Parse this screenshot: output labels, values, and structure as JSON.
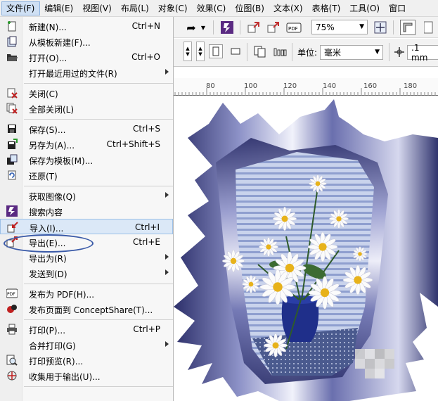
{
  "menubar": {
    "items": [
      "文件(F)",
      "编辑(E)",
      "视图(V)",
      "布局(L)",
      "对象(C)",
      "效果(C)",
      "位图(B)",
      "文本(X)",
      "表格(T)",
      "工具(O)",
      "窗口"
    ]
  },
  "toolbar": {
    "zoom_value": "75%",
    "units_label": "单位:",
    "units_value": "毫米",
    "nudge_value": ".1 mm"
  },
  "ruler": {
    "labels": [
      "80",
      "100",
      "120",
      "140",
      "160",
      "180"
    ]
  },
  "file_menu": {
    "items": [
      {
        "label": "新建(N)...",
        "shortcut": "Ctrl+N",
        "icon": "new-document-icon"
      },
      {
        "label": "从模板新建(F)...",
        "shortcut": "",
        "icon": "new-from-template-icon"
      },
      {
        "label": "打开(O)...",
        "shortcut": "Ctrl+O",
        "icon": "open-folder-icon"
      },
      {
        "label": "打开最近用过的文件(R)",
        "shortcut": "",
        "icon": ""
      },
      {
        "label": "关闭(C)",
        "shortcut": "",
        "icon": "close-document-icon"
      },
      {
        "label": "全部关闭(L)",
        "shortcut": "",
        "icon": "close-all-icon"
      },
      {
        "label": "保存(S)...",
        "shortcut": "Ctrl+S",
        "icon": "save-icon"
      },
      {
        "label": "另存为(A)...",
        "shortcut": "Ctrl+Shift+S",
        "icon": "save-as-icon"
      },
      {
        "label": "保存为模板(M)...",
        "shortcut": "",
        "icon": "save-template-icon"
      },
      {
        "label": "还原(T)",
        "shortcut": "",
        "icon": "revert-icon"
      },
      {
        "label": "获取图像(Q)",
        "shortcut": "",
        "icon": ""
      },
      {
        "label": "搜索内容",
        "shortcut": "",
        "icon": "search-content-icon"
      },
      {
        "label": "导入(I)...",
        "shortcut": "Ctrl+I",
        "icon": "import-icon"
      },
      {
        "label": "导出(E)...",
        "shortcut": "Ctrl+E",
        "icon": "export-icon"
      },
      {
        "label": "导出为(R)",
        "shortcut": "",
        "icon": ""
      },
      {
        "label": "发送到(D)",
        "shortcut": "",
        "icon": ""
      },
      {
        "label": "发布为 PDF(H)...",
        "shortcut": "",
        "icon": "pdf-icon"
      },
      {
        "label": "发布页面到 ConceptShare(T)...",
        "shortcut": "",
        "icon": "conceptshare-icon"
      },
      {
        "label": "打印(P)...",
        "shortcut": "Ctrl+P",
        "icon": "print-icon"
      },
      {
        "label": "合并打印(G)",
        "shortcut": "",
        "icon": ""
      },
      {
        "label": "打印预览(R)...",
        "shortcut": "",
        "icon": "print-preview-icon"
      },
      {
        "label": "收集用于输出(U)...",
        "shortcut": "",
        "icon": "collect-output-icon"
      }
    ]
  }
}
